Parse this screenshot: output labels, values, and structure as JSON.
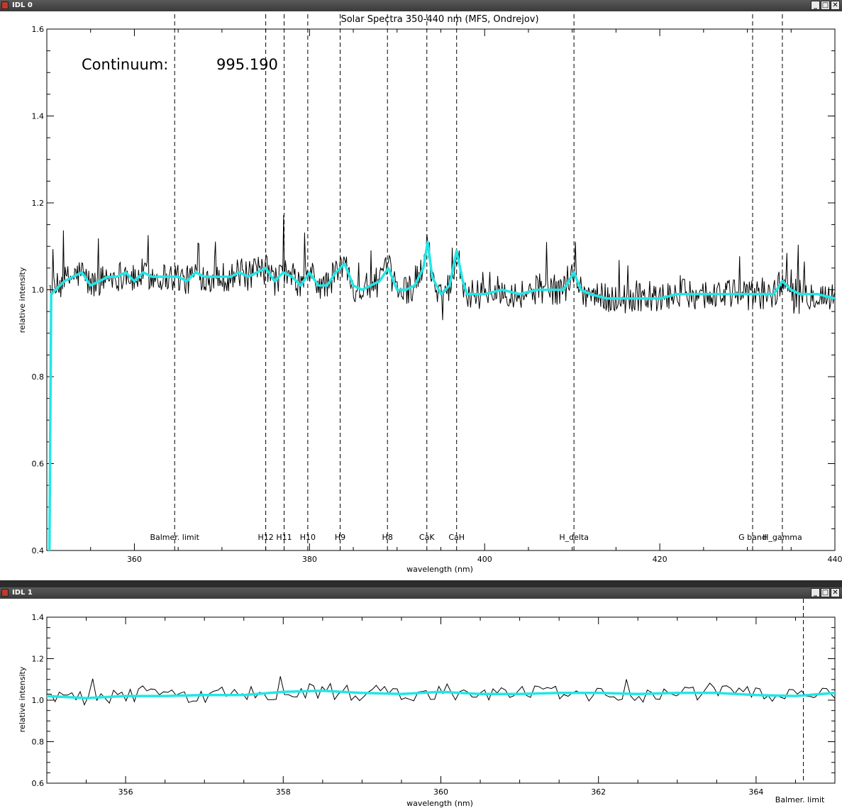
{
  "windows": [
    {
      "title": "IDL 0",
      "buttons": [
        "_",
        "□",
        "✕"
      ],
      "chart": {
        "type": "line",
        "title": "Solar Spectra 350-440 nm (MFS, Ondrejov)",
        "xlabel": "wavelength (nm)",
        "ylabel": "relative intensity",
        "xlim": [
          350,
          440
        ],
        "ylim": [
          0.4,
          1.6
        ],
        "xticks": [
          360,
          380,
          400,
          420,
          440
        ],
        "yticks": [
          0.4,
          0.6,
          0.8,
          1.0,
          1.2,
          1.4,
          1.6
        ],
        "annotation": {
          "label": "Continuum:",
          "value": "995.190"
        },
        "lines": [
          {
            "label": "Balmer. limit",
            "x": 364.6
          },
          {
            "label": "H12",
            "x": 375.0
          },
          {
            "label": "H11",
            "x": 377.1
          },
          {
            "label": "H10",
            "x": 379.8
          },
          {
            "label": "H9",
            "x": 383.5
          },
          {
            "label": "H8",
            "x": 388.9
          },
          {
            "label": "CaK",
            "x": 393.4
          },
          {
            "label": "CaH",
            "x": 396.8
          },
          {
            "label": "H_delta",
            "x": 410.2
          },
          {
            "label": "G band",
            "x": 430.6
          },
          {
            "label": "H_gamma",
            "x": 434.0
          }
        ],
        "smooth_series": {
          "color": "#22e6e6",
          "x": [
            350.3,
            350.5,
            351,
            352,
            353,
            354,
            355,
            356,
            357,
            358,
            359,
            360,
            361,
            362,
            363,
            364,
            365,
            366,
            367,
            368,
            369,
            370,
            371,
            372,
            373,
            374,
            375,
            376,
            377,
            378,
            379,
            380,
            381,
            382,
            383,
            384,
            385,
            386,
            387,
            388,
            389,
            390,
            391,
            392,
            393,
            393.5,
            394,
            395,
            396,
            396.8,
            397.5,
            398,
            399,
            400,
            402,
            404,
            406,
            408,
            409,
            410.2,
            411,
            412,
            414,
            416,
            418,
            420,
            422,
            424,
            426,
            428,
            430,
            432,
            433,
            434,
            435,
            436,
            438,
            440
          ],
          "y": [
            0.4,
            0.99,
            1.0,
            1.02,
            1.03,
            1.04,
            1.01,
            1.02,
            1.03,
            1.03,
            1.04,
            1.02,
            1.04,
            1.03,
            1.03,
            1.03,
            1.03,
            1.02,
            1.04,
            1.03,
            1.03,
            1.03,
            1.03,
            1.04,
            1.03,
            1.04,
            1.05,
            1.02,
            1.04,
            1.03,
            1.01,
            1.04,
            1.01,
            1.01,
            1.04,
            1.06,
            1.01,
            1.0,
            1.01,
            1.02,
            1.05,
            1.0,
            1.0,
            1.01,
            1.05,
            1.11,
            1.03,
            0.99,
            1.01,
            1.09,
            1.02,
            0.99,
            0.99,
            0.99,
            1.0,
            0.99,
            1.0,
            1.0,
            1.0,
            1.04,
            1.0,
            0.99,
            0.98,
            0.98,
            0.98,
            0.98,
            0.99,
            0.99,
            0.99,
            0.99,
            0.99,
            0.99,
            0.99,
            1.02,
            1.0,
            0.99,
            0.99,
            0.98
          ]
        },
        "noisy_series": {
          "color": "#000000",
          "x_start": 350.3,
          "x_end": 440,
          "points": 900,
          "amplitude": 0.035
        }
      }
    },
    {
      "title": "IDL 1",
      "buttons": [
        "_",
        "□",
        "✕"
      ],
      "chart": {
        "type": "line",
        "title": "",
        "xlabel": "wavelength (nm)",
        "ylabel": "relative intensity",
        "xlim": [
          355,
          365
        ],
        "ylim": [
          0.6,
          1.4
        ],
        "xticks": [
          356,
          358,
          360,
          362,
          364
        ],
        "yticks": [
          0.6,
          0.8,
          1.0,
          1.2,
          1.4
        ],
        "lines": [
          {
            "label": "Balmer. limit",
            "x": 364.6
          }
        ],
        "smooth_series": {
          "color": "#22e6e6",
          "x": [
            355,
            355.5,
            356,
            356.5,
            357,
            357.5,
            358,
            358.5,
            359,
            359.5,
            360,
            360.5,
            361,
            361.5,
            362,
            362.5,
            363,
            363.5,
            364,
            364.5,
            365
          ],
          "y": [
            1.02,
            1.01,
            1.02,
            1.02,
            1.025,
            1.025,
            1.04,
            1.045,
            1.035,
            1.03,
            1.04,
            1.03,
            1.03,
            1.035,
            1.035,
            1.03,
            1.035,
            1.035,
            1.025,
            1.02,
            1.035
          ]
        },
        "noisy_series": {
          "color": "#000000",
          "x_start": 355,
          "x_end": 365,
          "points": 190,
          "amplitude": 0.04
        }
      }
    }
  ]
}
